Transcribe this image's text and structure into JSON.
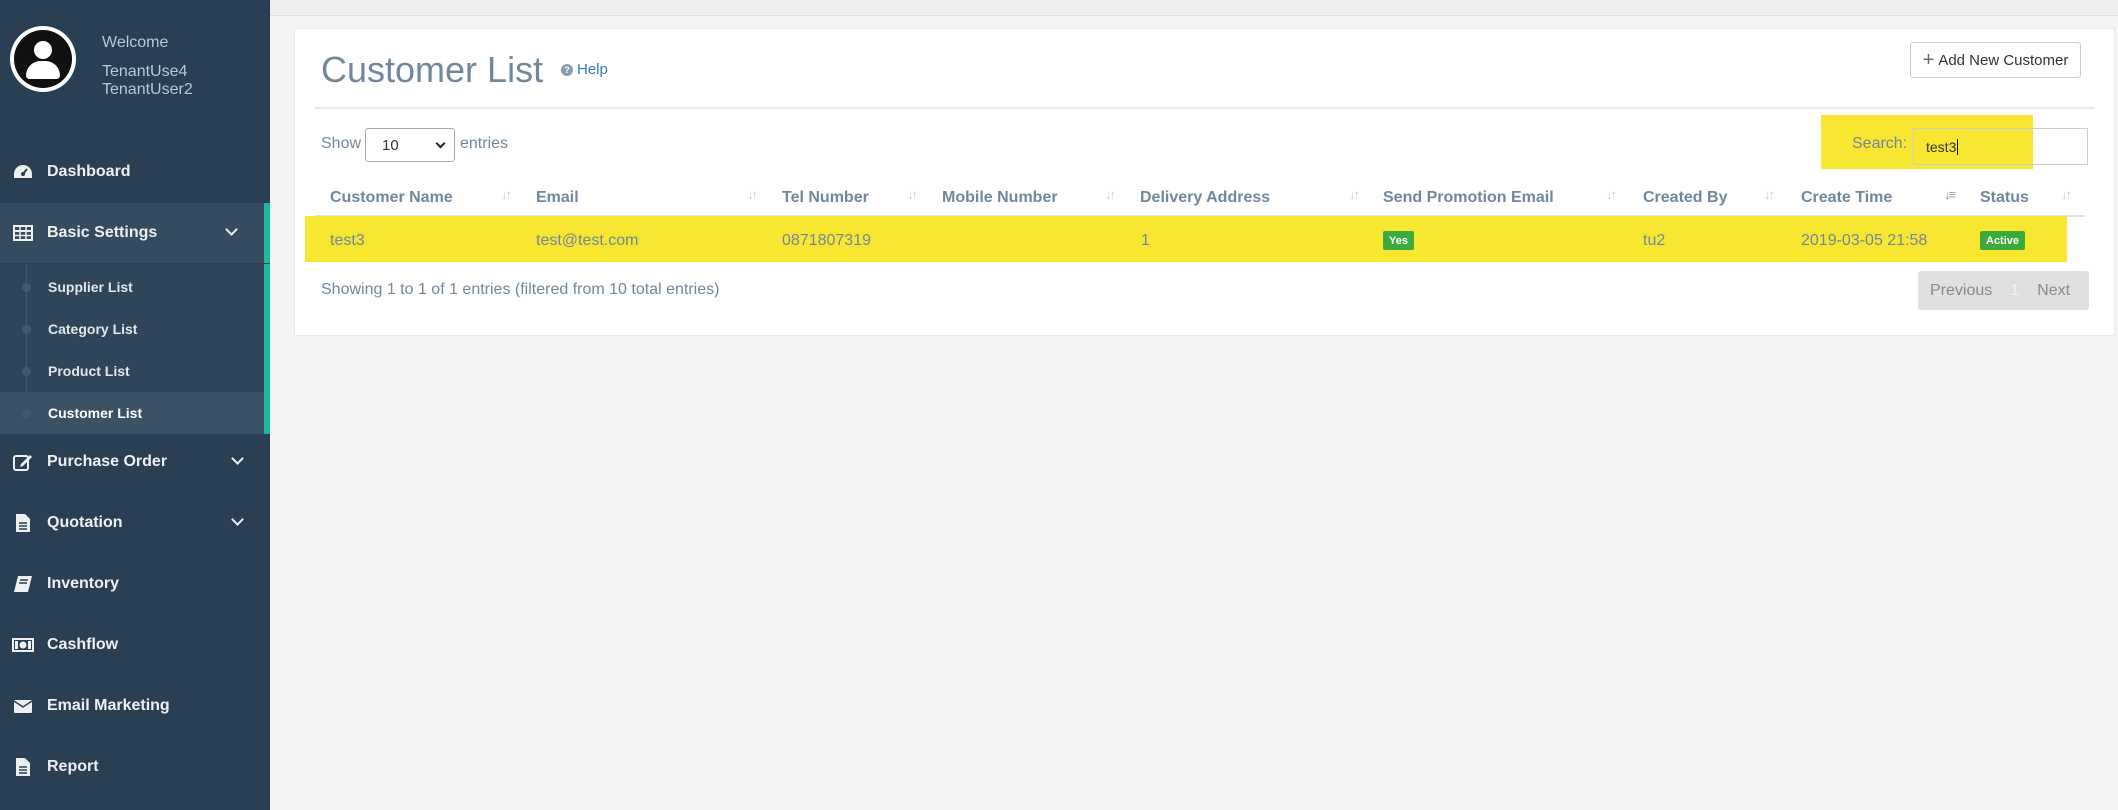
{
  "profile": {
    "welcome": "Welcome",
    "name_line1": "TenantUse4",
    "name_line2": "TenantUser2"
  },
  "menu": {
    "dashboard": "Dashboard",
    "basic_settings": "Basic Settings",
    "purchase_order": "Purchase Order",
    "quotation": "Quotation",
    "inventory": "Inventory",
    "cashflow": "Cashflow",
    "email_marketing": "Email Marketing",
    "report": "Report"
  },
  "submenu": {
    "supplier_list": "Supplier List",
    "category_list": "Category List",
    "product_list": "Product List",
    "customer_list": "Customer List"
  },
  "page": {
    "title": "Customer List",
    "help": "Help",
    "add_button": "Add New Customer"
  },
  "controls": {
    "show_label": "Show",
    "entries_value": "10",
    "entries_label": "entries",
    "search_label": "Search:",
    "search_value": "test3"
  },
  "table": {
    "headers": {
      "customer_name": "Customer Name",
      "email": "Email",
      "tel": "Tel Number",
      "mobile": "Mobile Number",
      "address": "Delivery Address",
      "promo": "Send Promotion Email",
      "created_by": "Created By",
      "create_time": "Create Time",
      "status": "Status"
    },
    "row": {
      "customer_name": "test3",
      "email": "test@test.com",
      "tel": "0871807319",
      "mobile": "",
      "address": "1",
      "promo": "Yes",
      "created_by": "tu2",
      "create_time": "2019-03-05 21:58",
      "status": "Active"
    }
  },
  "footer": {
    "info": "Showing 1 to 1 of 1 entries (filtered from 10 total entries)",
    "previous": "Previous",
    "page": "1",
    "next": "Next"
  },
  "colors": {
    "sidebar": "#2a3f54",
    "accent": "#1abb9c",
    "highlight": "#f7e731",
    "badge": "#3dab3b"
  }
}
